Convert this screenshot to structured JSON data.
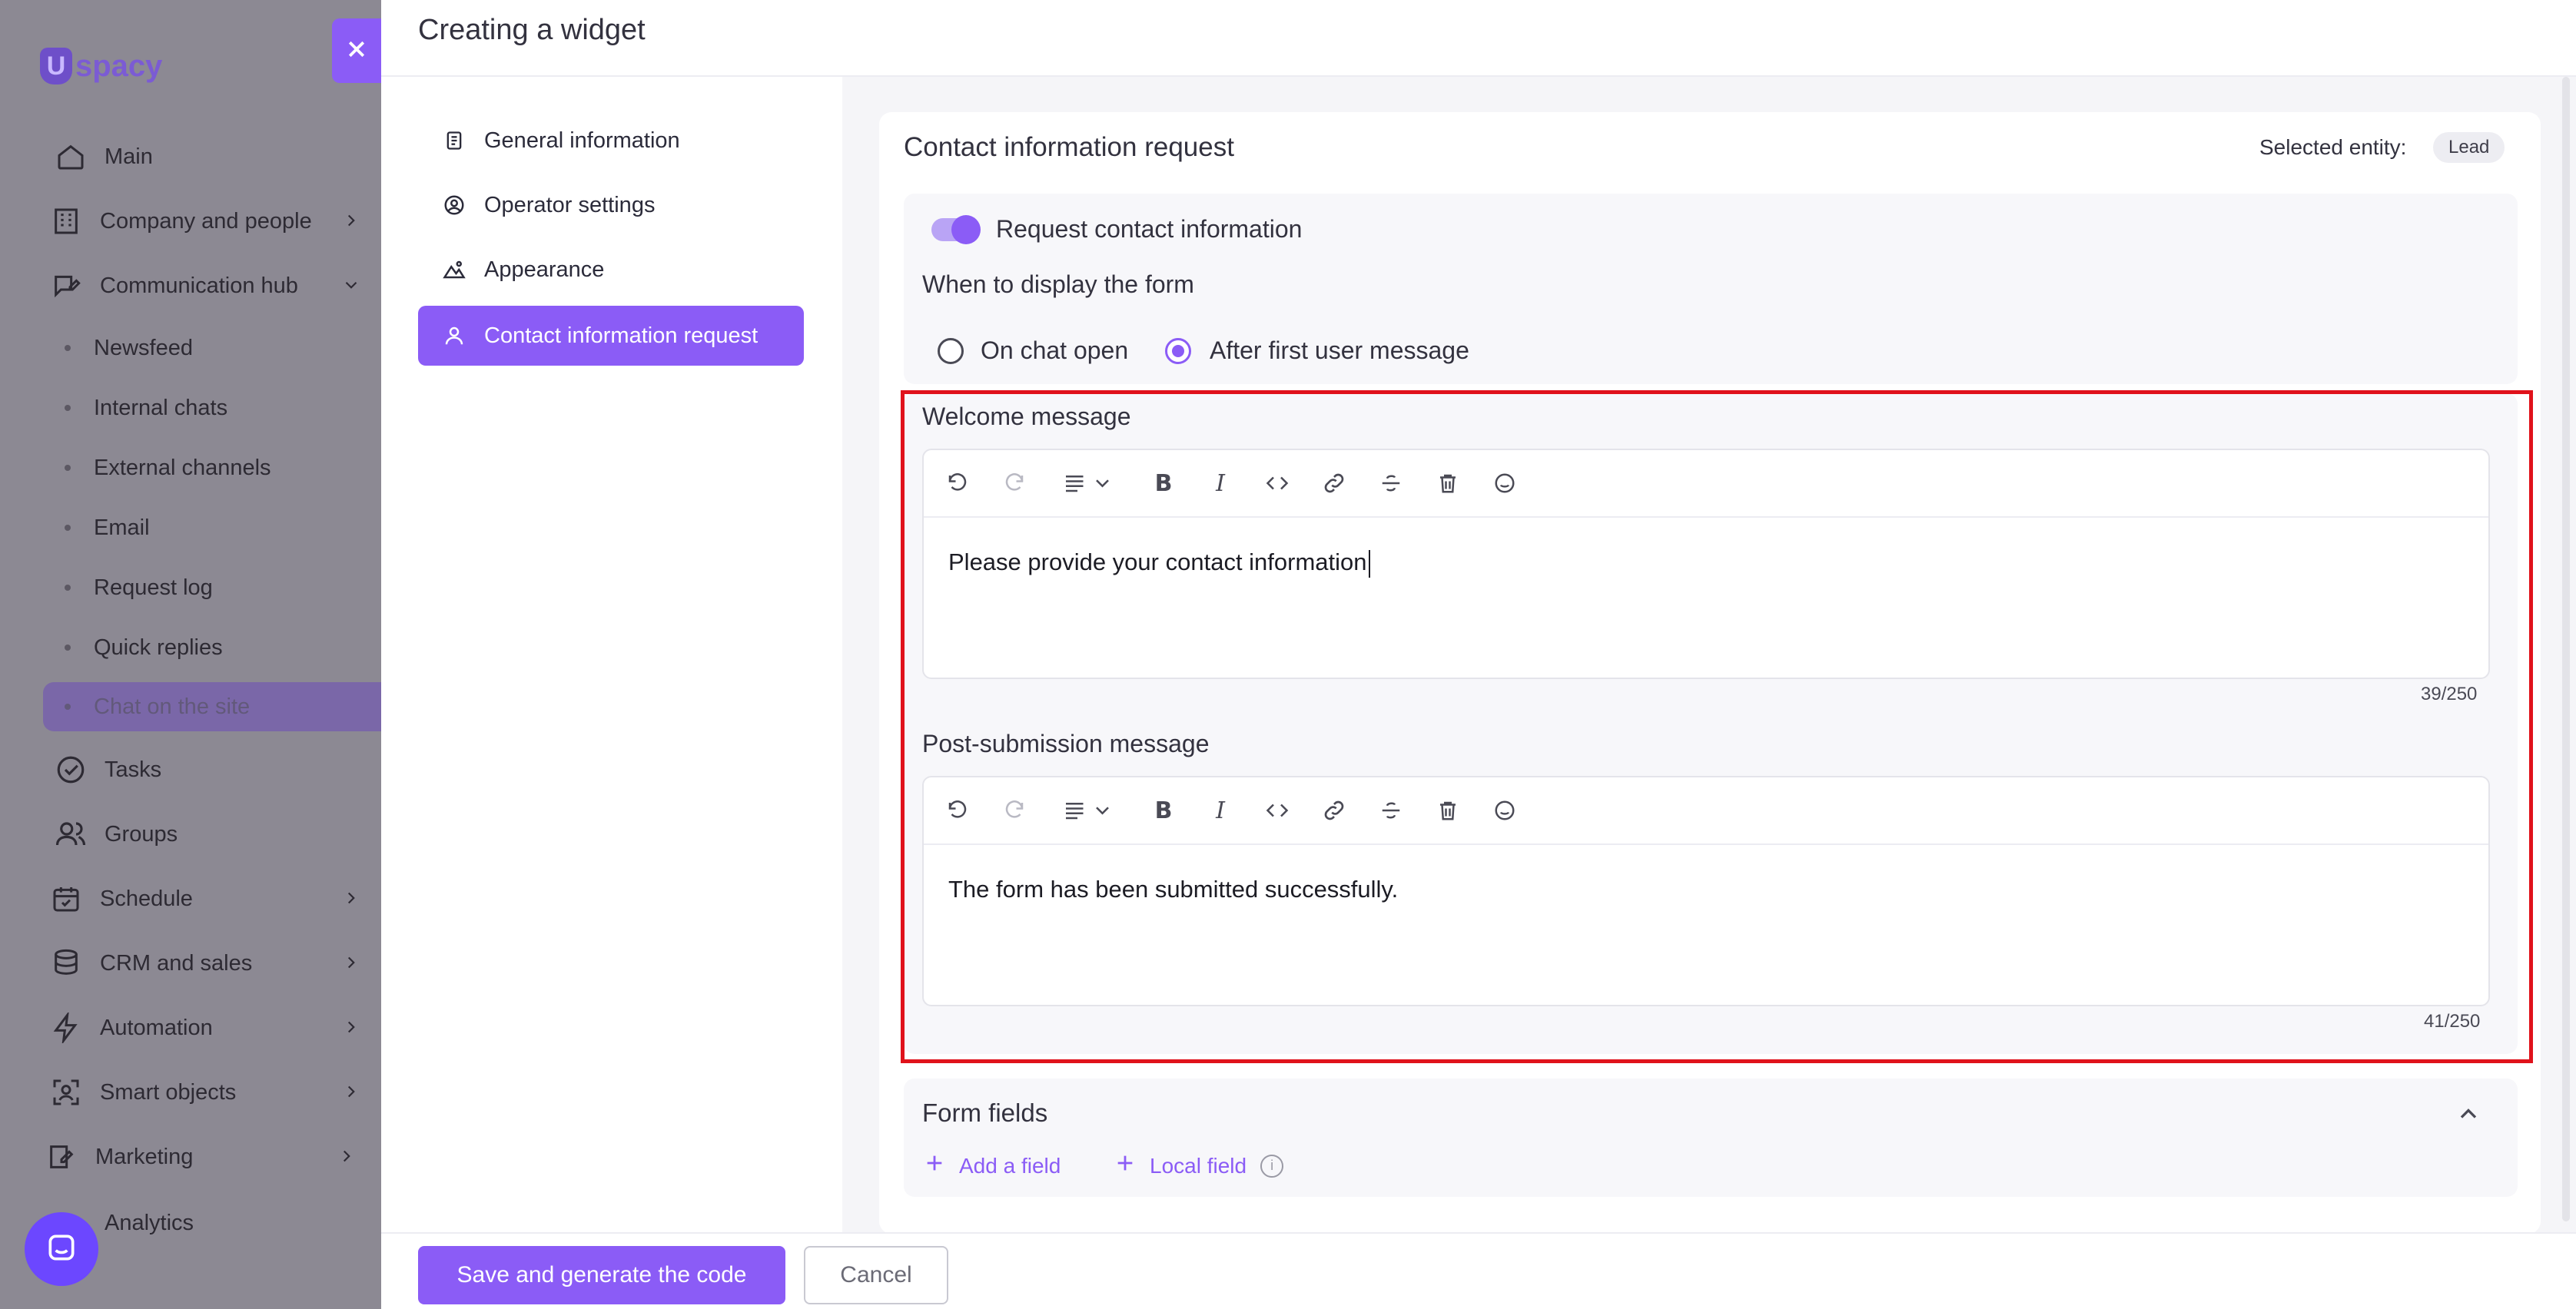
{
  "sidebar": {
    "logo": "spacy",
    "items": [
      {
        "label": "Main",
        "icon": "home-icon"
      },
      {
        "label": "Company and people",
        "icon": "building-icon"
      },
      {
        "label": "Communication hub",
        "icon": "chat-edit-icon"
      },
      {
        "label": "Tasks",
        "icon": "check-circle-icon"
      },
      {
        "label": "Groups",
        "icon": "users-icon"
      },
      {
        "label": "Schedule",
        "icon": "calendar-icon"
      },
      {
        "label": "CRM and sales",
        "icon": "database-icon"
      },
      {
        "label": "Automation",
        "icon": "lightning-icon"
      },
      {
        "label": "Smart objects",
        "icon": "scan-icon"
      },
      {
        "label": "Marketing",
        "icon": "marketing-icon"
      },
      {
        "label": "Analytics",
        "icon": "chart-icon"
      }
    ],
    "sub_items": [
      "Newsfeed",
      "Internal chats",
      "External channels",
      "Email",
      "Request log",
      "Quick replies",
      "Chat on the site"
    ]
  },
  "panel": {
    "title": "Creating a widget",
    "tabs": [
      "General information",
      "Operator settings",
      "Appearance",
      "Contact information request"
    ]
  },
  "card": {
    "title": "Contact information request",
    "entity_label": "Selected entity:",
    "entity_value": "Lead",
    "toggle_label": "Request contact information",
    "toggle_on": true,
    "when_label": "When to display the form",
    "radio_options": [
      "On chat open",
      "After first user message"
    ],
    "radio_selected": "After first user message",
    "welcome": {
      "label": "Welcome message",
      "text": "Please provide your contact information",
      "counter": "39/250"
    },
    "post_submission": {
      "label": "Post-submission message",
      "text": "The form has been submitted successfully.",
      "counter": "41/250"
    },
    "form_fields": {
      "label": "Form fields",
      "add_field": "Add a field",
      "local_field": "Local field"
    }
  },
  "footer": {
    "save_label": "Save and generate the code",
    "cancel_label": "Cancel"
  },
  "colors": {
    "accent": "#8b5cf6",
    "highlight": "#e0121b",
    "overlay": "#8c8993"
  }
}
